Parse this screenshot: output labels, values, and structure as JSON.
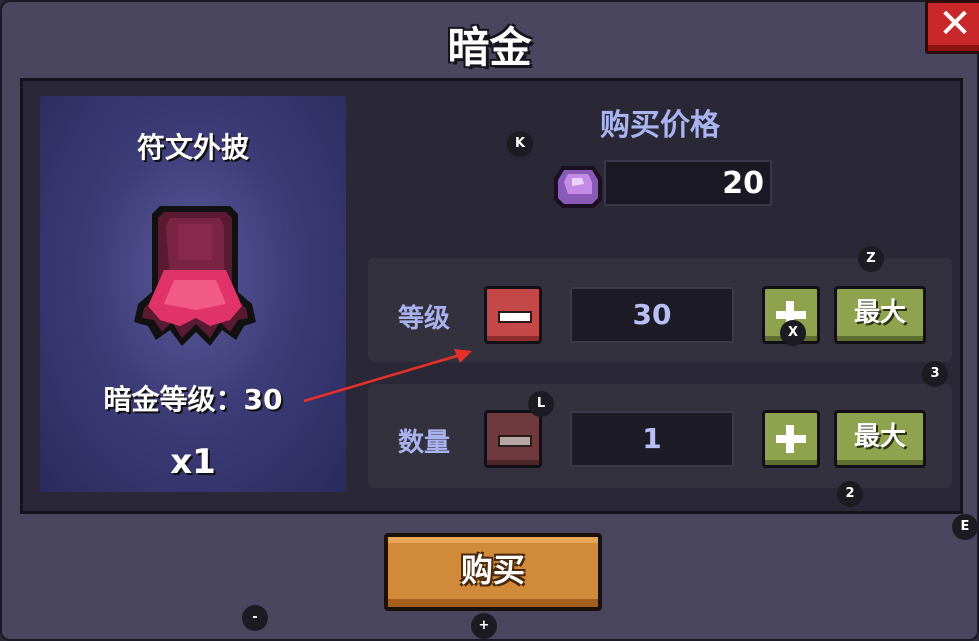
{
  "title": "暗金",
  "close_label": "✕",
  "item": {
    "name": "符文外披",
    "level_text": "暗金等级：30",
    "quantity_text": "x1"
  },
  "price": {
    "label": "购买价格",
    "value": "20"
  },
  "level_row": {
    "label": "等级",
    "value": "30",
    "max_label": "最大"
  },
  "quantity_row": {
    "label": "数量",
    "value": "1",
    "max_label": "最大"
  },
  "buy_label": "购买",
  "hotkeys": {
    "k": "K",
    "z": "Z",
    "x": "X",
    "three": "3",
    "l": "L",
    "two": "2",
    "e": "E",
    "minus": "-",
    "plus": "+"
  },
  "colors": {
    "accent_label": "#aab2ee",
    "buy_button": "#d18a3a",
    "max_button": "#8fa24e",
    "minus_active": "#c44848",
    "close_button": "#c8282a"
  }
}
